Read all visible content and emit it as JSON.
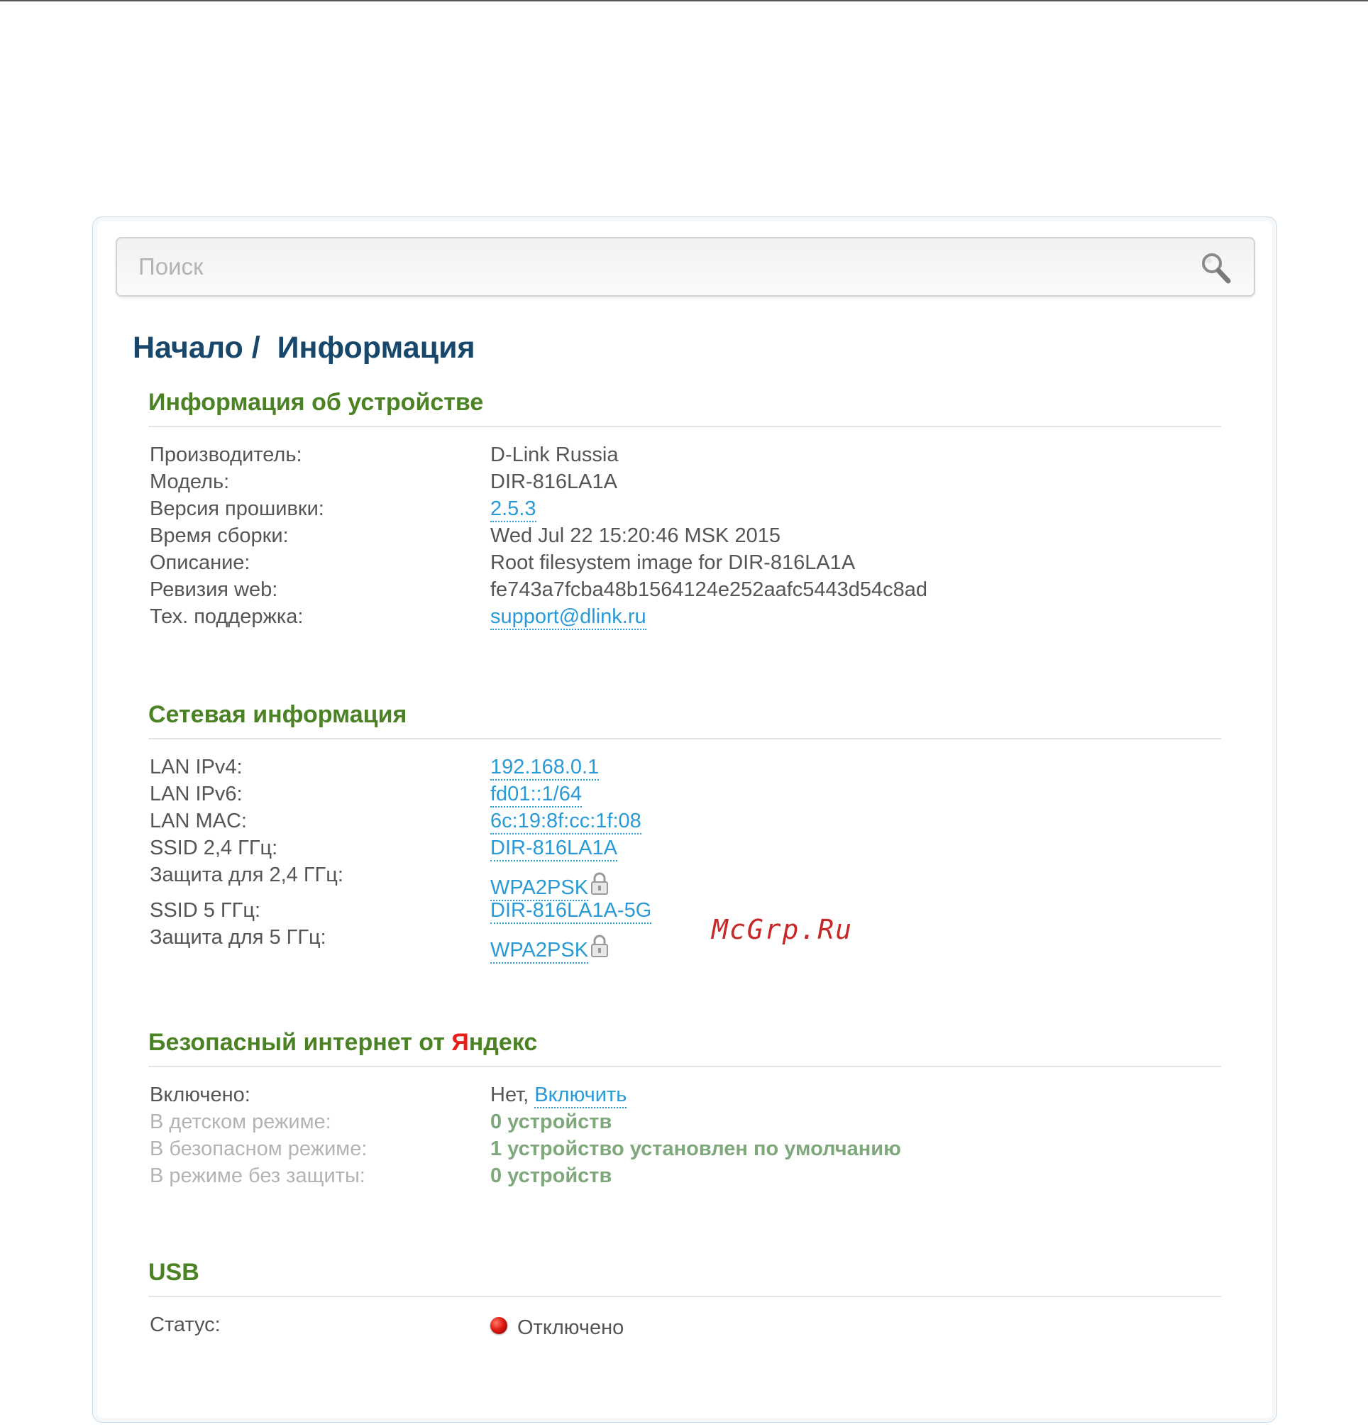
{
  "search": {
    "placeholder": "Поиск"
  },
  "breadcrumb": {
    "home": "Начало /",
    "current": "Информация"
  },
  "device_info": {
    "title": "Информация об устройстве",
    "rows": [
      {
        "label": "Производитель:",
        "value": "D-Link Russia"
      },
      {
        "label": "Модель:",
        "value": "DIR-816LA1A"
      },
      {
        "label": "Версия прошивки:",
        "value": "2.5.3"
      },
      {
        "label": "Время сборки:",
        "value": "Wed Jul 22 15:20:46 MSK 2015"
      },
      {
        "label": "Описание:",
        "value": "Root filesystem image for DIR-816LA1A"
      },
      {
        "label": "Ревизия web:",
        "value": "fe743a7fcba48b1564124e252aafc5443d54c8ad"
      },
      {
        "label": "Тех. поддержка:",
        "value": "support@dlink.ru"
      }
    ]
  },
  "network_info": {
    "title": "Сетевая информация",
    "rows": [
      {
        "label": "LAN IPv4:",
        "value": "192.168.0.1"
      },
      {
        "label": "LAN IPv6:",
        "value": "fd01::1/64"
      },
      {
        "label": "LAN MAC:",
        "value": "6c:19:8f:cc:1f:08"
      },
      {
        "label": "SSID 2,4 ГГц:",
        "value": "DIR-816LA1A"
      },
      {
        "label": "Защита для 2,4 ГГц:",
        "value": "WPA2PSK"
      },
      {
        "label": "SSID 5 ГГц:",
        "value": "DIR-816LA1A-5G"
      },
      {
        "label": "Защита для 5 ГГц:",
        "value": "WPA2PSK"
      }
    ]
  },
  "yandex": {
    "title_prefix": "Безопасный интернет от ",
    "title_ya": "Я",
    "title_rest": "ндекс",
    "rows": [
      {
        "label": "Включено:",
        "value": "Нет,",
        "link": "Включить"
      },
      {
        "label": "В детском режиме:",
        "value": "0 устройств"
      },
      {
        "label": "В безопасном режиме:",
        "value": "1 устройство установлен по умолчанию"
      },
      {
        "label": "В режиме без защиты:",
        "value": "0 устройств"
      }
    ]
  },
  "usb": {
    "title": "USB",
    "rows": [
      {
        "label": "Статус:",
        "value": "Отключено",
        "status_color": "#e01a10"
      }
    ]
  },
  "watermark": "McGrp.Ru",
  "colors": {
    "heading": "#17476b",
    "section": "#4a8224",
    "link": "#2a9ad6",
    "yandex_red": "#e81f18"
  }
}
